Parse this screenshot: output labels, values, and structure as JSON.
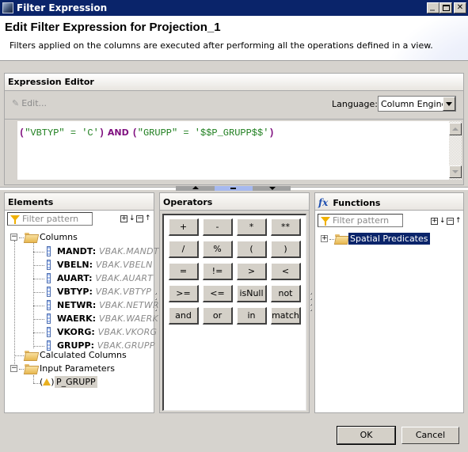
{
  "window": {
    "title": "Filter Expression",
    "controls": [
      "minimize",
      "maximize",
      "close"
    ]
  },
  "header": {
    "title": "Edit Filter Expression for Projection_1",
    "description": "Filters applied on the columns are executed after performing all the operations defined in a view."
  },
  "expression_editor": {
    "title": "Expression Editor",
    "edit_label": "Edit...",
    "language_label": "Language:",
    "language_value": "Column Engine",
    "expression_tokens": [
      {
        "text": "(",
        "type": "paren"
      },
      {
        "text": "\"VBTYP\"",
        "type": "string"
      },
      {
        "text": " = ",
        "type": "string"
      },
      {
        "text": "'C'",
        "type": "string"
      },
      {
        "text": ")",
        "type": "paren"
      },
      {
        "text": " AND ",
        "type": "keyword"
      },
      {
        "text": "(",
        "type": "paren"
      },
      {
        "text": "\"GRUPP\"",
        "type": "string"
      },
      {
        "text": " = ",
        "type": "string"
      },
      {
        "text": "'$$P_GRUPP$$'",
        "type": "string"
      },
      {
        "text": ")",
        "type": "paren"
      }
    ],
    "expression": "(\"VBTYP\" = 'C') AND (\"GRUPP\" = '$$P_GRUPP$$')"
  },
  "elements": {
    "title": "Elements",
    "filter_placeholder": "Filter pattern",
    "tree": {
      "columns_label": "Columns",
      "columns": [
        {
          "name": "MANDT",
          "source": "VBAK.MANDT"
        },
        {
          "name": "VBELN",
          "source": "VBAK.VBELN"
        },
        {
          "name": "AUART",
          "source": "VBAK.AUART"
        },
        {
          "name": "VBTYP",
          "source": "VBAK.VBTYP"
        },
        {
          "name": "NETWR",
          "source": "VBAK.NETWR"
        },
        {
          "name": "WAERK",
          "source": "VBAK.WAERK"
        },
        {
          "name": "VKORG",
          "source": "VBAK.VKORG"
        },
        {
          "name": "GRUPP",
          "source": "VBAK.GRUPP"
        }
      ],
      "calculated_columns_label": "Calculated Columns",
      "input_parameters_label": "Input Parameters",
      "input_parameters": [
        {
          "name": "P_GRUPP",
          "selected": true
        }
      ]
    }
  },
  "operators": {
    "title": "Operators",
    "buttons": [
      [
        "+",
        "-",
        "*",
        "**"
      ],
      [
        "/",
        "%",
        "(",
        ")"
      ],
      [
        "=",
        "!=",
        ">",
        "<"
      ],
      [
        ">=",
        "<=",
        "isNull",
        "not"
      ],
      [
        "and",
        "or",
        "in",
        "match"
      ]
    ]
  },
  "functions": {
    "title": "Functions",
    "icon": "fx",
    "filter_placeholder": "Filter pattern",
    "tree": [
      {
        "label": "Spatial Predicates",
        "selected": true,
        "expandable": true
      }
    ]
  },
  "footer": {
    "ok_label": "OK",
    "cancel_label": "Cancel"
  }
}
